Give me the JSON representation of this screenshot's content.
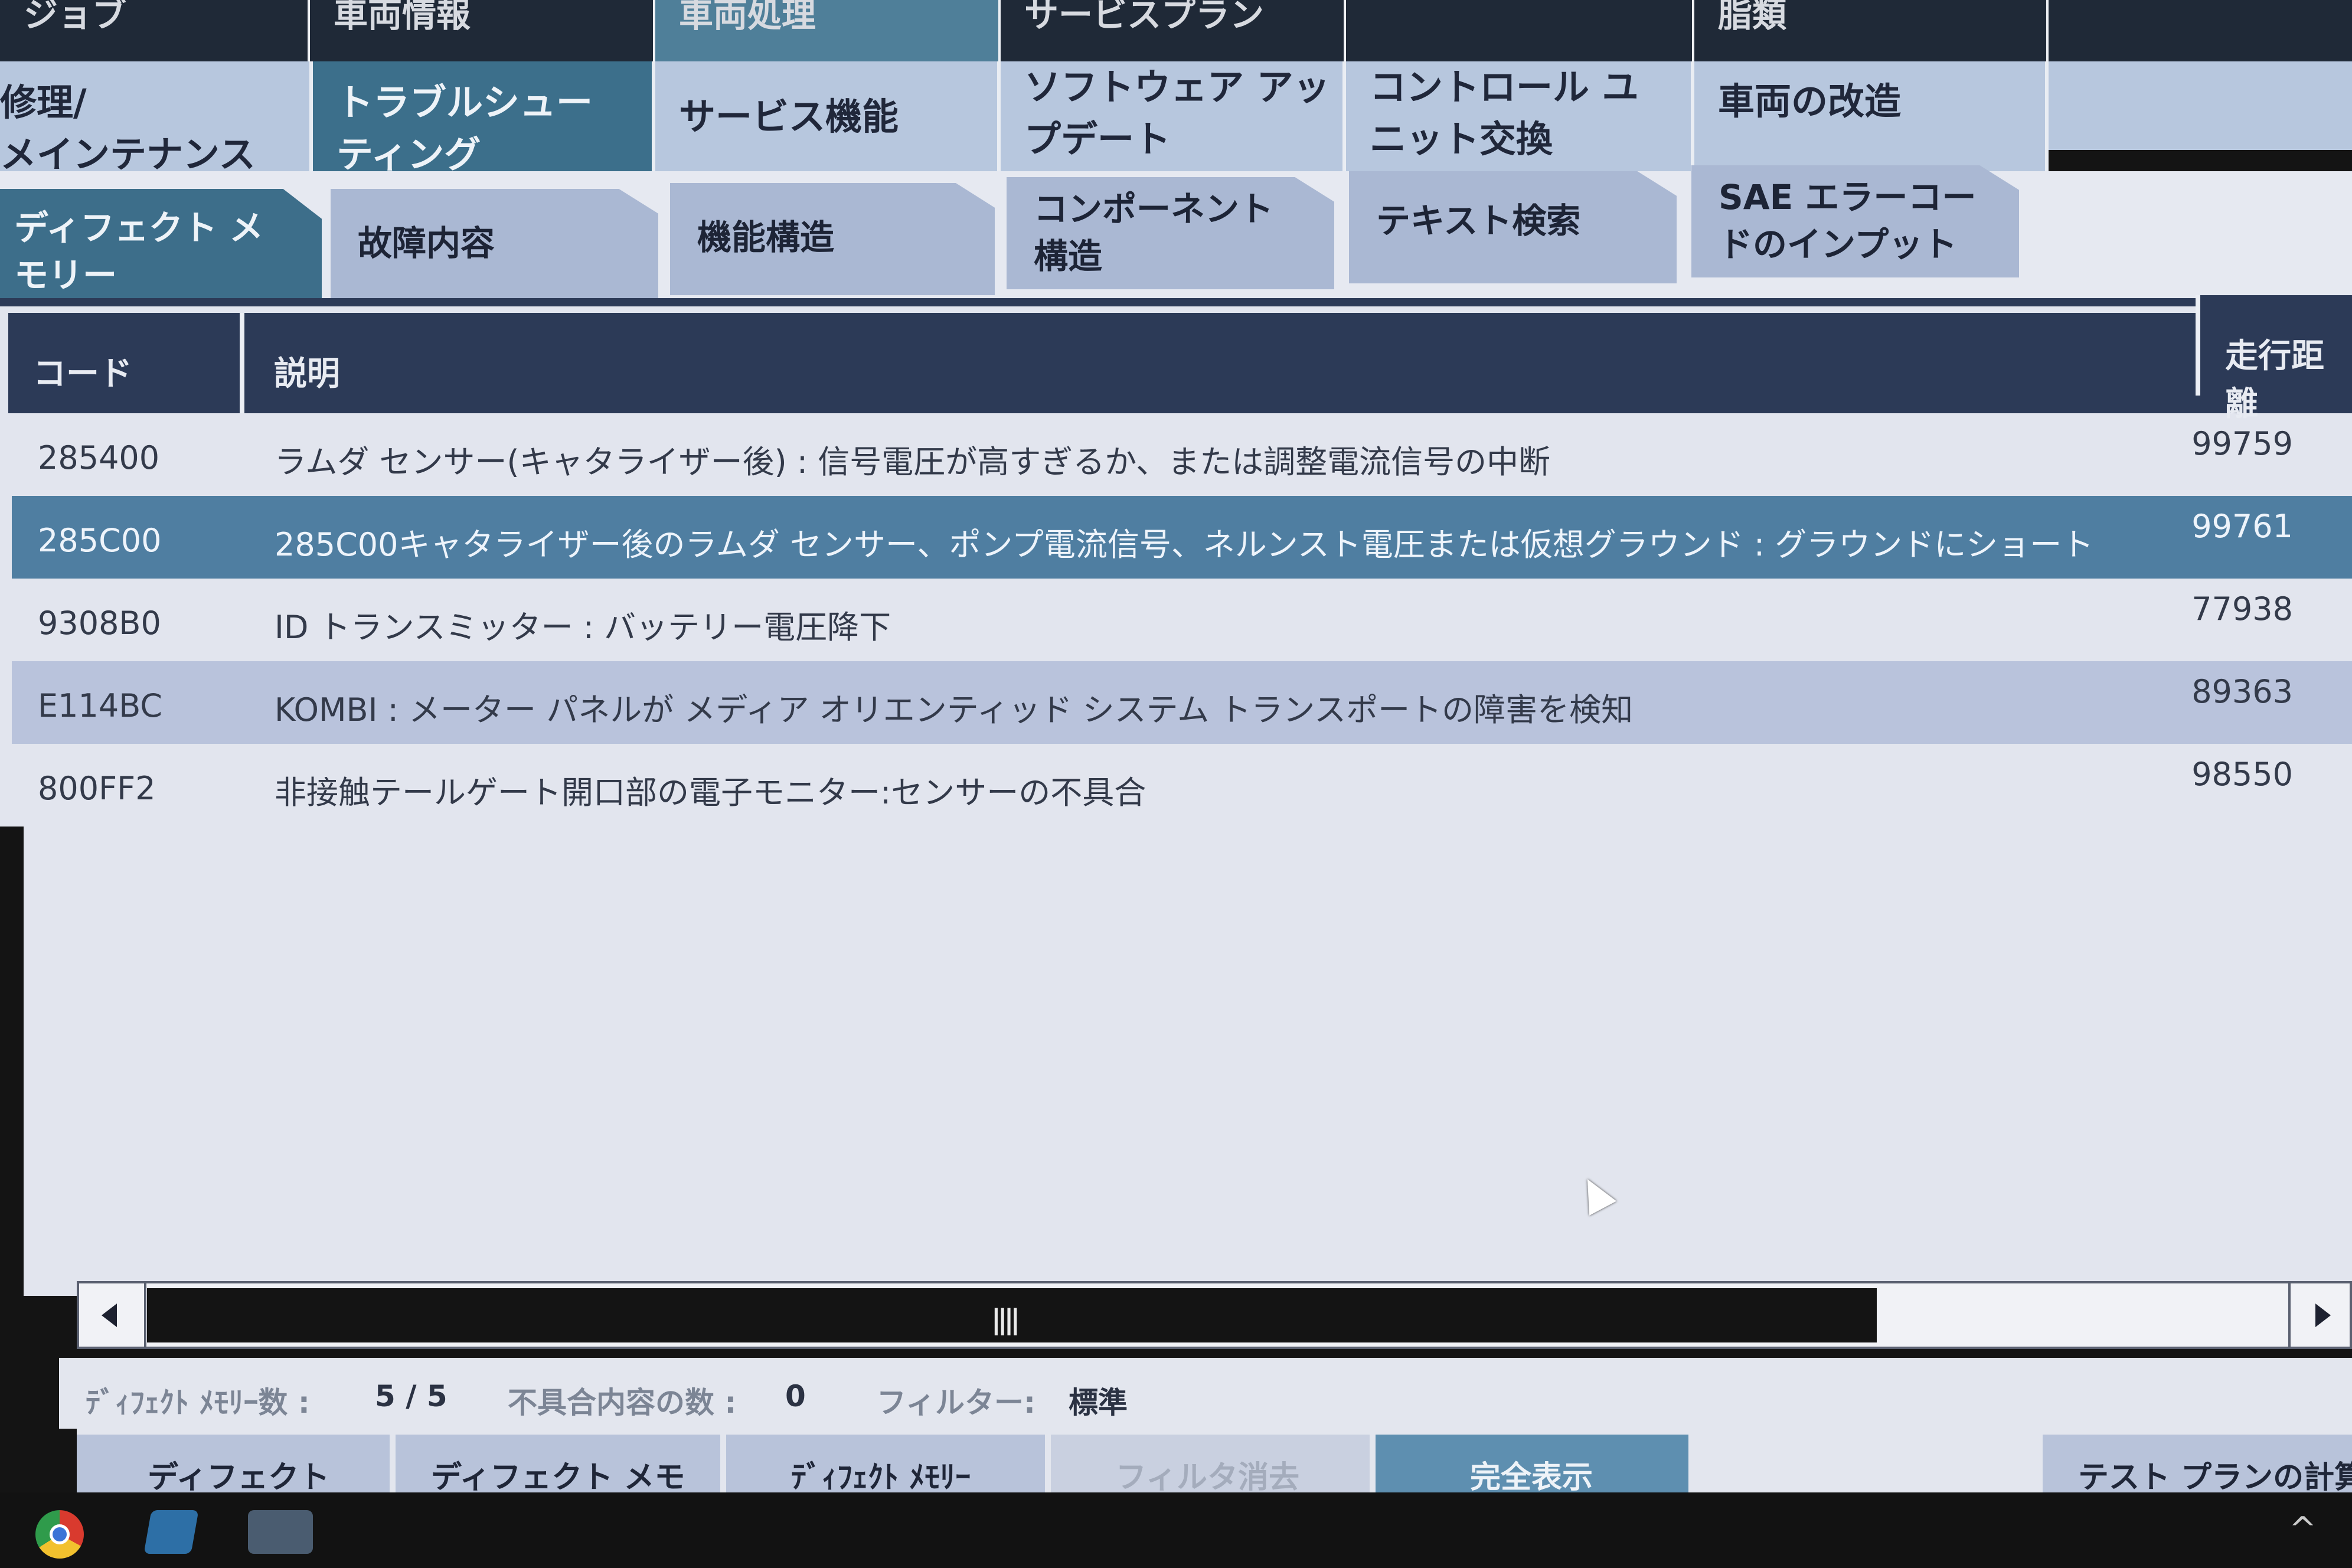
{
  "nav_main": [
    {
      "label": "ジョブ",
      "active": false
    },
    {
      "label": "車両情報",
      "active": false
    },
    {
      "label": "車両処理",
      "active": true
    },
    {
      "label": "サービスプラン",
      "active": false
    },
    {
      "label": "",
      "active": false
    },
    {
      "label": "脂類",
      "active": false
    }
  ],
  "nav_sub": [
    {
      "label": "修理/\nメインテナンス",
      "active": false
    },
    {
      "label": "トラブルシュー\nティング",
      "active": true
    },
    {
      "label": "サービス機能",
      "active": false
    },
    {
      "label": "ソフトウェア アッ\nプデート",
      "active": false
    },
    {
      "label": "コントロール ユ\nニット交換",
      "active": false
    },
    {
      "label": "車両の改造",
      "active": false
    }
  ],
  "tabs": [
    {
      "label": "ディフェクト メ\nモリー",
      "active": true
    },
    {
      "label": "故障内容",
      "active": false
    },
    {
      "label": "機能構造",
      "active": false
    },
    {
      "label": "コンポーネント\n構造",
      "active": false
    },
    {
      "label": "テキスト検索",
      "active": false
    },
    {
      "label": "SAE エラーコー\nドのインプット",
      "active": false
    }
  ],
  "table": {
    "headers": {
      "code": "コード",
      "description": "説明",
      "mileage": "走行距離"
    },
    "rows": [
      {
        "code": "285400",
        "description": "ラムダ センサー(キャタライザー後) : 信号電圧が高すぎるか、または調整電流信号の中断",
        "mileage": "99759",
        "state": "normal"
      },
      {
        "code": "285C00",
        "description": "285C00キャタライザー後のラムダ センサー、ポンプ電流信号、ネルンスト電圧または仮想グラウンド : グラウンドにショート",
        "mileage": "99761",
        "state": "selected"
      },
      {
        "code": "9308B0",
        "description": "ID トランスミッター : バッテリー電圧降下",
        "mileage": "77938",
        "state": "normal"
      },
      {
        "code": "E114BC",
        "description": "KOMBI : メーター パネルが メディア オリエンティッド システム トランスポートの障害を検知",
        "mileage": "89363",
        "state": "alt"
      },
      {
        "code": "800FF2",
        "description": "非接触テールゲート開口部の電子モニター:センサーの不具合",
        "mileage": "98550",
        "state": "normal"
      }
    ]
  },
  "scrollbar": {
    "grip": "||||"
  },
  "status": {
    "defect_count_label": "ﾃﾞｨﾌｪｸﾄ ﾒﾓﾘｰ数 :",
    "defect_count_value": "5 / 5",
    "fault_count_label": "不具合内容の数 :",
    "fault_count_value": "0",
    "filter_label": "フィルター:",
    "filter_value": "標準"
  },
  "buttons": [
    {
      "label": "ディフェクト",
      "style": "normal"
    },
    {
      "label": "ディフェクト メモ",
      "style": "normal"
    },
    {
      "label": "ﾃﾞｨﾌｪｸﾄ ﾒﾓﾘｰ",
      "style": "normal"
    },
    {
      "label": "フィルタ消去",
      "style": "dim"
    },
    {
      "label": "完全表示",
      "style": "blue"
    },
    {
      "label": "テスト プランの計算",
      "style": "normal"
    }
  ],
  "taskbar": {
    "icons": [
      "chrome-icon",
      "explorer-icon",
      "ista-icon"
    ],
    "tray": "^"
  }
}
